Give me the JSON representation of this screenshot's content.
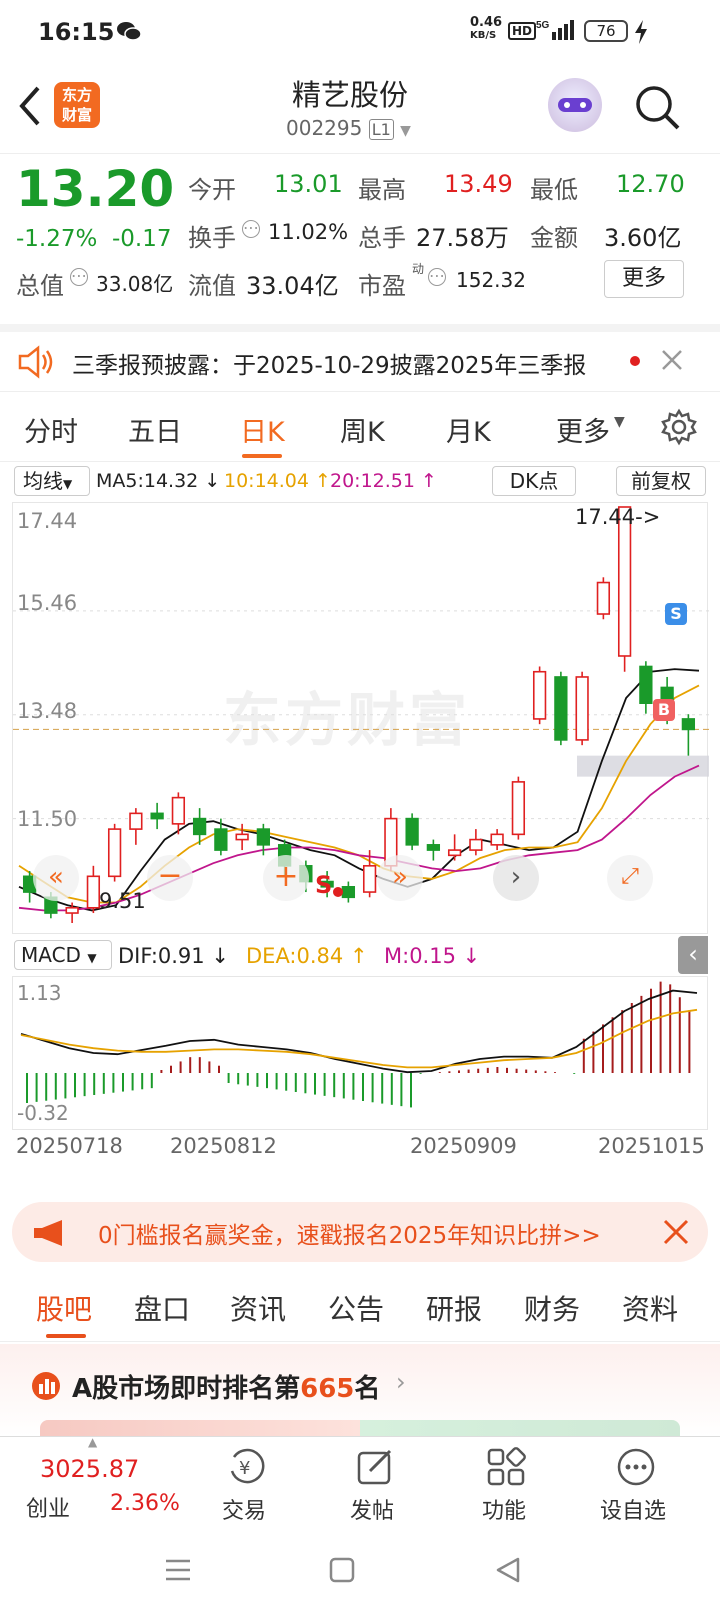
{
  "status": {
    "time": "16:15",
    "net_speed": "0.46",
    "net_unit": "KB/S",
    "battery": "76"
  },
  "header": {
    "title": "精艺股份",
    "code": "002295",
    "level": "L1",
    "logo_line1": "东方",
    "logo_line2": "财富"
  },
  "quote": {
    "price": "13.20",
    "change_pct": "-1.27%",
    "change": "-0.17",
    "open_label": "今开",
    "open": "13.01",
    "high_label": "最高",
    "high": "13.49",
    "low_label": "最低",
    "low": "12.70",
    "turnover_label": "换手",
    "turnover": "11.02%",
    "volume_label": "总手",
    "volume": "27.58万",
    "amount_label": "金额",
    "amount": "3.60亿",
    "mcap_label": "总值",
    "mcap": "33.08亿",
    "float_label": "流值",
    "float": "33.04亿",
    "pe_label": "市盈",
    "pe_sup": "动",
    "pe": "152.32",
    "more_button": "更多"
  },
  "notice": {
    "text": "三季报预披露：于2025-10-29披露2025年三季报"
  },
  "tabs": [
    "分时",
    "五日",
    "日K",
    "周K",
    "月K",
    "更多"
  ],
  "active_tab": 2,
  "kline": {
    "ma_select": "均线",
    "ma5": "MA5:14.32",
    "ma10": "10:14.04",
    "ma20": "20:12.51",
    "dk_button": "DK点",
    "adjust_button": "前复权",
    "y_ticks": [
      "17.44",
      "15.46",
      "13.48",
      "11.50"
    ],
    "max_label": "17.44->",
    "min_label": "9.51",
    "watermark": "东方财富",
    "s_marker": "S",
    "b_marker": "B",
    "s_marker2": "S"
  },
  "macd": {
    "select": "MACD",
    "dif": "DIF:0.91",
    "dea": "DEA:0.84",
    "m": "M:0.15",
    "y_top": "1.13",
    "y_bottom": "-0.32"
  },
  "x_dates": [
    "20250718",
    "20250812",
    "20250909",
    "20251015"
  ],
  "chart_data": {
    "type": "candlestick",
    "title": "",
    "ylim": [
      9.51,
      17.44
    ],
    "x_labels": [
      "20250718",
      "20250812",
      "20250909",
      "20251015"
    ],
    "series": [
      {
        "name": "MA5",
        "values": [
          10.2,
          10.0,
          9.85,
          9.75,
          9.85,
          10.5,
          11.1,
          11.4,
          11.45,
          11.3,
          11.2,
          11.05,
          10.9,
          10.8,
          10.55,
          10.35,
          10.2,
          10.35,
          10.8,
          11.1,
          11.0,
          10.9,
          10.95,
          11.25,
          12.6,
          13.8,
          14.3,
          14.35,
          14.32
        ]
      },
      {
        "name": "MA10",
        "values": [
          10.6,
          10.3,
          10.0,
          9.9,
          9.9,
          10.2,
          10.6,
          10.95,
          11.2,
          11.3,
          11.25,
          11.15,
          11.05,
          10.95,
          10.8,
          10.55,
          10.4,
          10.35,
          10.5,
          10.75,
          10.9,
          10.95,
          10.95,
          11.05,
          11.7,
          12.6,
          13.3,
          13.8,
          14.04
        ]
      },
      {
        "name": "MA20",
        "values": [
          9.8,
          9.75,
          9.75,
          9.8,
          9.9,
          10.05,
          10.25,
          10.45,
          10.65,
          10.8,
          10.9,
          10.95,
          10.95,
          10.9,
          10.8,
          10.75,
          10.65,
          10.55,
          10.5,
          10.55,
          10.7,
          10.8,
          10.85,
          10.9,
          11.1,
          11.5,
          11.95,
          12.3,
          12.51
        ]
      }
    ],
    "candles": [
      {
        "o": 10.4,
        "c": 10.1,
        "h": 10.5,
        "l": 9.9
      },
      {
        "o": 10.0,
        "c": 9.7,
        "h": 10.1,
        "l": 9.6
      },
      {
        "o": 9.7,
        "c": 9.8,
        "h": 9.9,
        "l": 9.51
      },
      {
        "o": 9.8,
        "c": 10.4,
        "h": 10.6,
        "l": 9.7
      },
      {
        "o": 10.4,
        "c": 11.3,
        "h": 11.4,
        "l": 10.3
      },
      {
        "o": 11.3,
        "c": 11.6,
        "h": 11.7,
        "l": 11.0
      },
      {
        "o": 11.6,
        "c": 11.5,
        "h": 11.8,
        "l": 11.3
      },
      {
        "o": 11.4,
        "c": 11.9,
        "h": 12.0,
        "l": 11.2
      },
      {
        "o": 11.5,
        "c": 11.2,
        "h": 11.7,
        "l": 11.0
      },
      {
        "o": 11.3,
        "c": 10.9,
        "h": 11.5,
        "l": 10.8
      },
      {
        "o": 11.1,
        "c": 11.2,
        "h": 11.4,
        "l": 10.9
      },
      {
        "o": 11.3,
        "c": 11.0,
        "h": 11.4,
        "l": 10.8
      },
      {
        "o": 11.0,
        "c": 10.6,
        "h": 11.1,
        "l": 10.4
      },
      {
        "o": 10.6,
        "c": 10.3,
        "h": 10.7,
        "l": 10.1
      },
      {
        "o": 10.3,
        "c": 10.2,
        "h": 10.5,
        "l": 10.0
      },
      {
        "o": 10.2,
        "c": 10.0,
        "h": 10.3,
        "l": 9.9
      },
      {
        "o": 10.1,
        "c": 10.6,
        "h": 10.9,
        "l": 10.0
      },
      {
        "o": 10.6,
        "c": 11.5,
        "h": 11.7,
        "l": 10.5
      },
      {
        "o": 11.5,
        "c": 11.0,
        "h": 11.6,
        "l": 10.9
      },
      {
        "o": 11.0,
        "c": 10.9,
        "h": 11.1,
        "l": 10.7
      },
      {
        "o": 10.8,
        "c": 10.9,
        "h": 11.2,
        "l": 10.7
      },
      {
        "o": 10.9,
        "c": 11.1,
        "h": 11.3,
        "l": 10.8
      },
      {
        "o": 11.0,
        "c": 11.2,
        "h": 11.3,
        "l": 10.9
      },
      {
        "o": 11.2,
        "c": 12.2,
        "h": 12.3,
        "l": 11.1
      },
      {
        "o": 13.4,
        "c": 14.3,
        "h": 14.4,
        "l": 13.3
      },
      {
        "o": 14.2,
        "c": 13.0,
        "h": 14.3,
        "l": 12.9
      },
      {
        "o": 13.0,
        "c": 14.2,
        "h": 14.3,
        "l": 12.9
      },
      {
        "o": 15.4,
        "c": 16.0,
        "h": 16.1,
        "l": 15.3
      },
      {
        "o": 14.6,
        "c": 17.44,
        "h": 17.44,
        "l": 14.3
      },
      {
        "o": 14.4,
        "c": 13.7,
        "h": 14.5,
        "l": 13.5
      },
      {
        "o": 14.0,
        "c": 13.5,
        "h": 14.2,
        "l": 13.3
      },
      {
        "o": 13.4,
        "c": 13.2,
        "h": 13.49,
        "l": 12.7
      }
    ]
  },
  "ad": {
    "text": "0门槛报名赢奖金，速戳报名2025年知识比拼>>"
  },
  "section_tabs": [
    "股吧",
    "盘口",
    "资讯",
    "公告",
    "研报",
    "财务",
    "资料"
  ],
  "ranking": {
    "prefix": "A股市场即时排名第",
    "rank": "665",
    "suffix": "名"
  },
  "bottom": {
    "index_value": "3025.87",
    "index_name": "创业",
    "index_change": "2.36%",
    "trade": "交易",
    "post": "发帖",
    "functions": "功能",
    "watchlist": "设自选"
  }
}
